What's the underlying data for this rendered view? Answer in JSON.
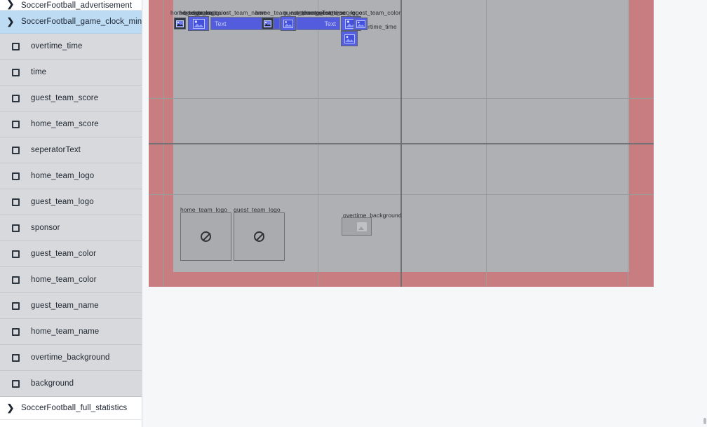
{
  "sidebar": {
    "top_group_partial": {
      "label": "SoccerFootball_advertisement",
      "arrow": "chevron-right-icon"
    },
    "selected_group": {
      "label": "SoccerFootball_game_clock_mini",
      "arrow": "chevron-right-icon"
    },
    "items": [
      {
        "label": "overtime_time",
        "icon": "checkbox-square-icon"
      },
      {
        "label": "time",
        "icon": "checkbox-square-icon"
      },
      {
        "label": "guest_team_score",
        "icon": "checkbox-square-icon"
      },
      {
        "label": "home_team_score",
        "icon": "checkbox-square-icon"
      },
      {
        "label": "seperatorText",
        "icon": "checkbox-square-icon"
      },
      {
        "label": "home_team_logo",
        "icon": "checkbox-square-icon"
      },
      {
        "label": "guest_team_logo",
        "icon": "checkbox-square-icon"
      },
      {
        "label": "sponsor",
        "icon": "checkbox-square-icon"
      },
      {
        "label": "guest_team_color",
        "icon": "checkbox-square-icon"
      },
      {
        "label": "home_team_color",
        "icon": "checkbox-square-icon"
      },
      {
        "label": "guest_team_name",
        "icon": "checkbox-square-icon"
      },
      {
        "label": "home_team_name",
        "icon": "checkbox-square-icon"
      },
      {
        "label": "overtime_background",
        "icon": "checkbox-square-icon"
      },
      {
        "label": "background",
        "icon": "checkbox-square-icon"
      }
    ],
    "bottom_group": {
      "label": "SoccerFootball_full_statistics",
      "arrow": "chevron-right-icon"
    }
  },
  "canvas": {
    "outer_color": "#c87e80",
    "inner_color": "#aeb0b3",
    "widget_color": "#4b55e0",
    "labels": [
      {
        "text": "home_team_logo"
      },
      {
        "text": "background"
      },
      {
        "text": "sponsor"
      },
      {
        "text": "home_team_color"
      },
      {
        "text": "guest_team_name"
      },
      {
        "text": "home_team_name"
      },
      {
        "text": "guest_team_score"
      },
      {
        "text": "seperatorText"
      },
      {
        "text": "home_team_score"
      },
      {
        "text": "guest_team_logo"
      },
      {
        "text": "time"
      },
      {
        "text": "guest_team_color"
      },
      {
        "text": "overtime_time"
      }
    ],
    "text_widgets": [
      {
        "value": "Text",
        "align": "left"
      },
      {
        "value": "Text",
        "align": "right"
      }
    ],
    "logo_placeholders": [
      {
        "label": "home_team_logo",
        "icon": "no-image-icon"
      },
      {
        "label": "guest_team_logo",
        "icon": "no-image-icon"
      }
    ],
    "overtime": {
      "label": "overtime_background",
      "icon": "broken-image-icon"
    }
  }
}
